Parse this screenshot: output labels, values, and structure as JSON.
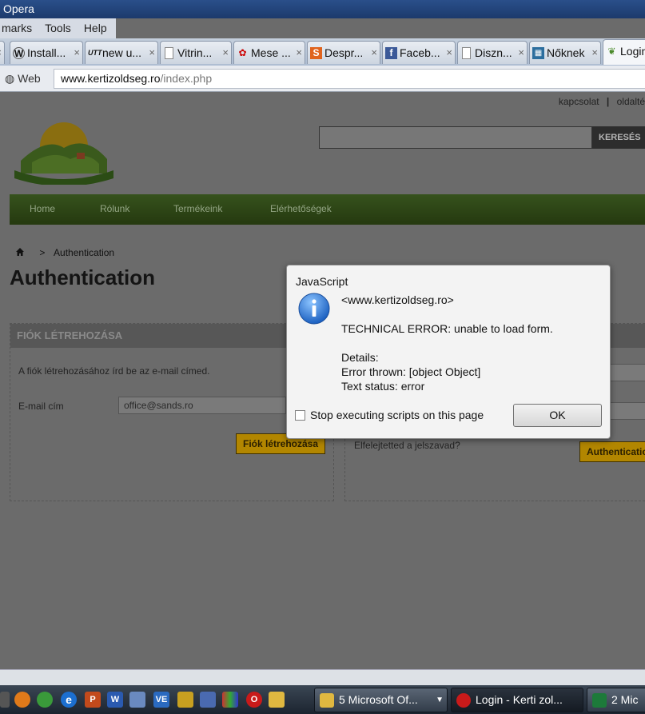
{
  "window": {
    "title": "Opera"
  },
  "menu": {
    "items": [
      "marks",
      "Tools",
      "Help"
    ]
  },
  "tabs": [
    {
      "label": "Install...",
      "icon": "wordpress-icon"
    },
    {
      "label": "new u...",
      "icon": "utt-icon"
    },
    {
      "label": "Vitrin...",
      "icon": "page-icon"
    },
    {
      "label": "Mese ...",
      "icon": "mese-icon"
    },
    {
      "label": "Despr...",
      "icon": "s-icon"
    },
    {
      "label": "Faceb...",
      "icon": "facebook-icon"
    },
    {
      "label": "Diszn...",
      "icon": "page-icon"
    },
    {
      "label": "Nőknek",
      "icon": "nok-icon"
    },
    {
      "label": "Login",
      "icon": "leaf-icon"
    }
  ],
  "address": {
    "web_label": "Web",
    "url_host": "www.kertizoldseg.ro",
    "url_path": "/index.php"
  },
  "site": {
    "top_links": {
      "contact": "kapcsolat",
      "separator": "|",
      "sitemap": "oldalté"
    },
    "search_button": "KERESÉS",
    "nav": [
      "Home",
      "Rólunk",
      "Termékeink",
      "Elérhetőségek"
    ],
    "breadcrumb": {
      "separator": ">",
      "current": "Authentication"
    },
    "page_title": "Authentication",
    "create_account": {
      "heading": "FIÓK LÉTREHOZÁSA",
      "description": "A fiók létrehozásához írd be az e-mail címed.",
      "email_label": "E-mail cím",
      "email_value": "office@sands.ro",
      "button": "Fiók létrehozása"
    },
    "login": {
      "forgot_password": "Elfelejtetted a jelszavad?",
      "button": "Authenticatio"
    }
  },
  "dialog": {
    "title": "JavaScript",
    "origin": "<www.kertizoldseg.ro>",
    "message": "TECHNICAL ERROR: unable to load form.",
    "details_heading": "Details:",
    "error_thrown": "Error thrown: [object Object]",
    "text_status": "Text status: error",
    "checkbox_label": "Stop executing scripts on this page",
    "checkbox_checked": false,
    "ok_button": "OK"
  },
  "taskbar": {
    "tasks": [
      {
        "label": "5 Microsoft Of...",
        "count": "5"
      },
      {
        "label": "Login - Kerti zol..."
      },
      {
        "label": "2 Mic",
        "count": "2"
      }
    ]
  }
}
